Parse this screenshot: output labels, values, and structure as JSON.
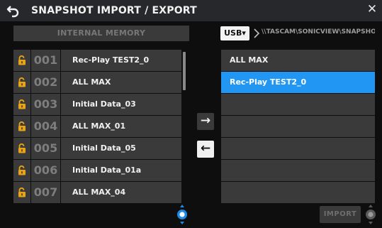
{
  "window": {
    "title": "SNAPSHOT IMPORT / EXPORT",
    "close_glyph": "✕"
  },
  "left_panel": {
    "header": "INTERNAL MEMORY",
    "rows": [
      {
        "number": "001",
        "name": "Rec-Play TEST2_0",
        "locked": true
      },
      {
        "number": "002",
        "name": "ALL MAX",
        "locked": true
      },
      {
        "number": "003",
        "name": "Initial Data_03",
        "locked": true
      },
      {
        "number": "004",
        "name": "ALL MAX_01",
        "locked": true
      },
      {
        "number": "005",
        "name": "Initial Data_05",
        "locked": true
      },
      {
        "number": "006",
        "name": "Initial Data_01a",
        "locked": true
      },
      {
        "number": "007",
        "name": "ALL MAX_04",
        "locked": true
      }
    ]
  },
  "transfer": {
    "to_usb_glyph": "→",
    "to_memory_glyph": "←"
  },
  "right_panel": {
    "device_label": "USB▾",
    "path": "\\\\TASCAM\\SONICVIEW\\SNAPSHOT\\",
    "rows": [
      {
        "name": "ALL MAX",
        "selected": false
      },
      {
        "name": "Rec-Play TEST2_0",
        "selected": true
      },
      {
        "name": "",
        "selected": false
      },
      {
        "name": "",
        "selected": false
      },
      {
        "name": "",
        "selected": false
      },
      {
        "name": "",
        "selected": false
      },
      {
        "name": "",
        "selected": false
      }
    ]
  },
  "footer": {
    "import_label": "IMPORT"
  },
  "colors": {
    "accent": "#2196f3",
    "lock_icon": "#e8a317",
    "panel": "#3a3a3a"
  },
  "icons": [
    "back-icon",
    "close-icon",
    "lock-icon",
    "chevron-right-icon",
    "arrow-right-icon",
    "arrow-left-icon",
    "encoder-knob-icon"
  ]
}
